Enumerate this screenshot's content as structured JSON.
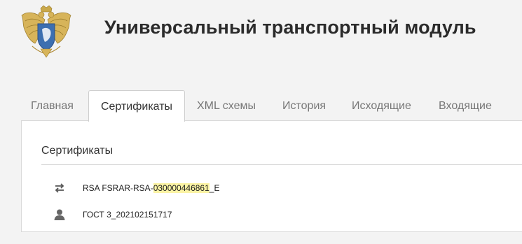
{
  "header": {
    "title": "Универсальный транспортный модуль",
    "logo_icon": "coat-of-arms-emblem-icon"
  },
  "tabs": [
    {
      "label": "Главная",
      "active": false
    },
    {
      "label": "Сертификаты",
      "active": true
    },
    {
      "label": "XML схемы",
      "active": false
    },
    {
      "label": "История",
      "active": false
    },
    {
      "label": "Исходящие",
      "active": false
    },
    {
      "label": "Входящие",
      "active": false
    }
  ],
  "panel": {
    "title": "Сертификаты",
    "certificates": [
      {
        "icon": "exchange-arrows-icon",
        "prefix": "RSA FSRAR-RSA-",
        "highlight": "030000446861",
        "suffix": "_E"
      },
      {
        "icon": "user-icon",
        "prefix": "ГОСТ 3_202102151717",
        "highlight": "",
        "suffix": ""
      }
    ]
  },
  "colors": {
    "page_background": "#f3f3f3",
    "panel_background": "#ffffff",
    "highlight": "#fbf3a4",
    "inactive_tab_text": "#777777"
  }
}
